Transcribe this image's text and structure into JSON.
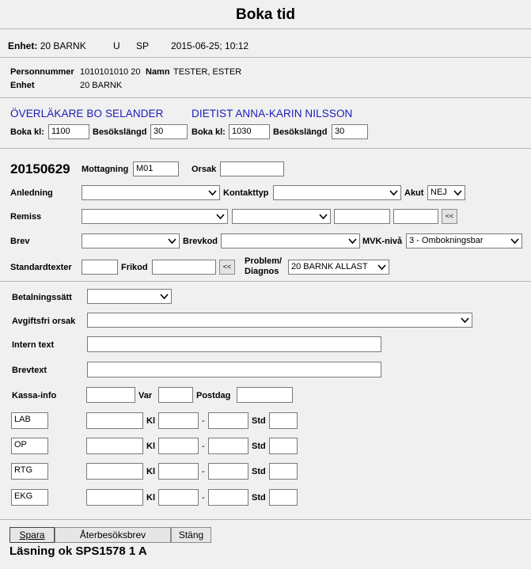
{
  "window": {
    "title": "Boka tid"
  },
  "header": {
    "enhet_label": "Enhet:",
    "enhet_value": "20 BARNK",
    "u": "U",
    "sp": "SP",
    "datetime": "2015-06-25; 10:12"
  },
  "patient": {
    "personnummer_label": "Personnummer",
    "personnummer_value": "1010101010 20",
    "namn_label": "Namn",
    "namn_value": "TESTER, ESTER",
    "enhet_label": "Enhet",
    "enhet_value": "20 BARNK"
  },
  "providers": [
    {
      "name": "ÖVERLÄKARE BO SELANDER",
      "boka_label": "Boka kl:",
      "boka_value": "1100",
      "langd_label": "Besökslängd",
      "langd_value": "30"
    },
    {
      "name": "DIETIST ANNA-KARIN NILSSON",
      "boka_label": "Boka kl:",
      "boka_value": "1030",
      "langd_label": "Besökslängd",
      "langd_value": "30"
    }
  ],
  "booking": {
    "date": "20150629",
    "mottagning_label": "Mottagning",
    "mottagning_value": "M01",
    "orsak_label": "Orsak",
    "orsak_value": "",
    "anledning_label": "Anledning",
    "kontakttyp_label": "Kontakttyp",
    "akut_label": "Akut",
    "akut_value": "NEJ",
    "remiss_label": "Remiss",
    "brev_label": "Brev",
    "brevkod_label": "Brevkod",
    "mvk_label": "MVK-nivå",
    "mvk_value": "3 - Ombokningsbar",
    "standardtexter_label": "Standardtexter",
    "frikod_label": "Frikod",
    "problem_label_1": "Problem/",
    "problem_label_2": "Diagnos",
    "problem_value": "20 BARNK ALLAST",
    "back_button": "<<"
  },
  "payment": {
    "betalningssatt_label": "Betalningssätt",
    "avgiftsfri_label": "Avgiftsfri orsak",
    "intern_label": "Intern text",
    "brevtext_label": "Brevtext",
    "kassa_label": "Kassa-info",
    "var_label": "Var",
    "postdag_label": "Postdag"
  },
  "resources": [
    {
      "code": "LAB",
      "kl_label": "Kl",
      "dash": "-",
      "std_label": "Std"
    },
    {
      "code": "OP",
      "kl_label": "Kl",
      "dash": "-",
      "std_label": "Std"
    },
    {
      "code": "RTG",
      "kl_label": "Kl",
      "dash": "-",
      "std_label": "Std"
    },
    {
      "code": "EKG",
      "kl_label": "Kl",
      "dash": "-",
      "std_label": "Std"
    }
  ],
  "footer": {
    "spara": "Spara",
    "aterbesok": "Återbesöksbrev",
    "stang": "Stäng",
    "status": "Läsning ok SPS1578 1 A"
  }
}
